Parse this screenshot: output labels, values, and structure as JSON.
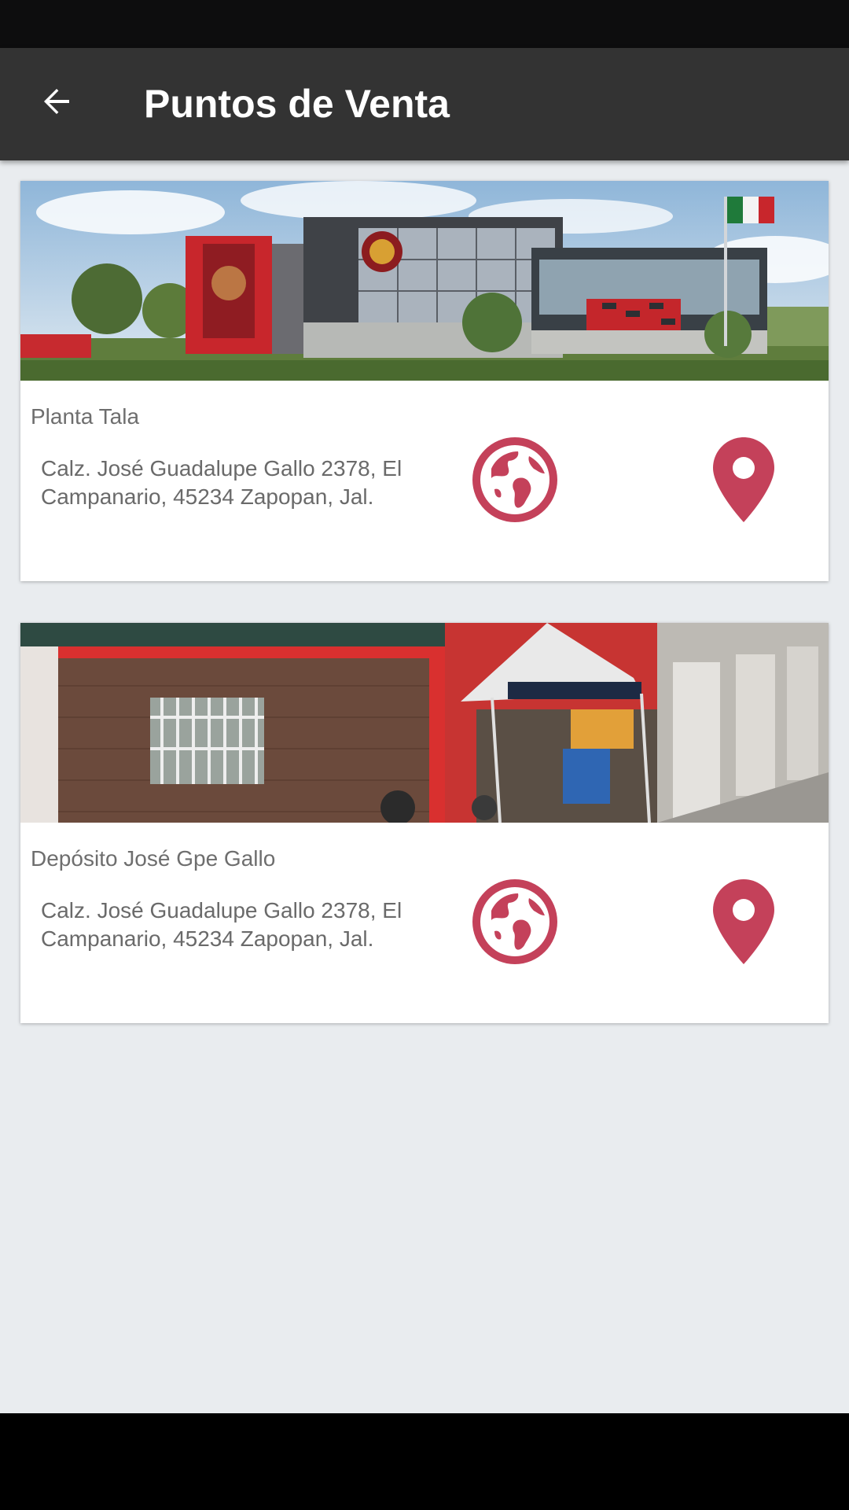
{
  "app_bar": {
    "title": "Puntos de Venta",
    "back_icon": "arrow-back-icon"
  },
  "colors": {
    "app_bar": "#333333",
    "accent": "#c4415a",
    "background": "#e9ecef"
  },
  "locations": [
    {
      "photo": "plant-building-photo",
      "name": "Planta Tala",
      "address": "Calz. José Guadalupe Gallo 2378, El Campanario, 45234 Zapopan, Jal.",
      "web_icon": "globe-icon",
      "map_icon": "map-pin-icon"
    },
    {
      "photo": "depot-storefront-photo",
      "name": "Depósito José Gpe Gallo",
      "address": "Calz. José Guadalupe Gallo 2378, El Campanario, 45234 Zapopan, Jal.",
      "web_icon": "globe-icon",
      "map_icon": "map-pin-icon"
    }
  ]
}
